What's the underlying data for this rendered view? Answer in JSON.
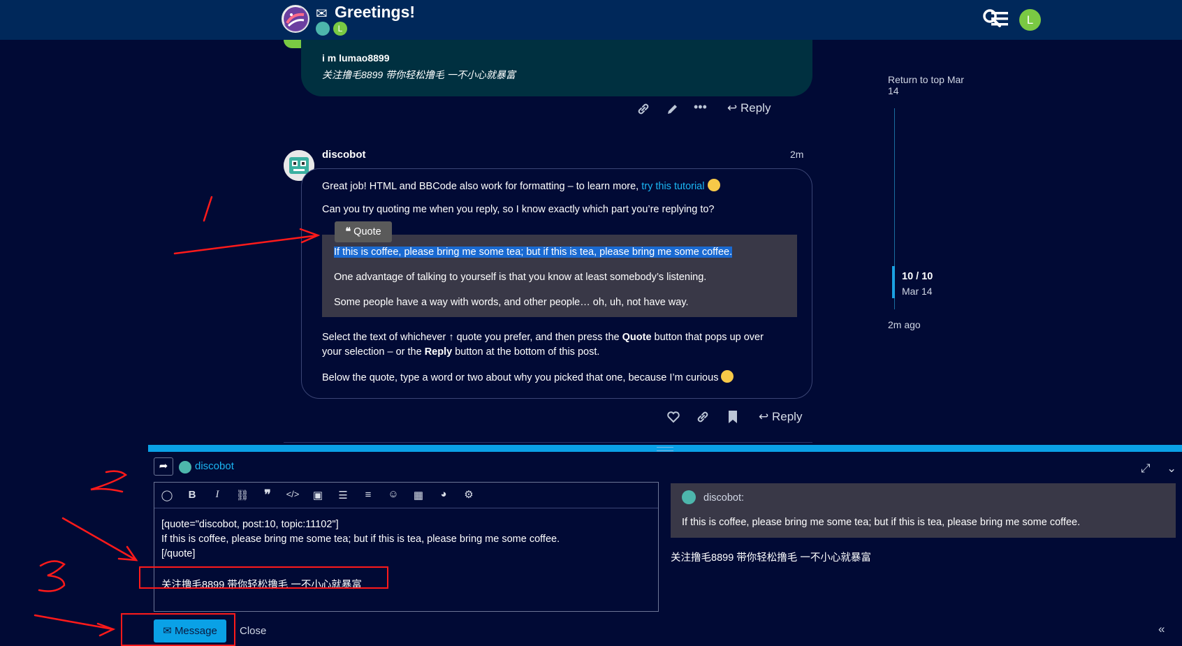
{
  "header": {
    "env_icon": "envelope-icon",
    "title": "Greetings!",
    "participant_2_initial": "L",
    "user_initial": "L"
  },
  "post1": {
    "line1": "i m lumao8899",
    "line2": "关注撸毛8899 带你轻松撸毛 一不小心就暴富",
    "reply_label": "Reply"
  },
  "post2": {
    "author": "discobot",
    "time": "2m",
    "p1_text": "Great job! HTML and BBCode also work for formatting – to learn more, ",
    "p1_link": "try this tutorial",
    "p2": "Can you try quoting me when you reply, so I know exactly which part you’re replying to?",
    "quotes": [
      "If this is coffee, please bring me some tea; but if this is tea, please bring me some coffee.",
      "One advantage of talking to yourself is that you know at least somebody’s listening.",
      "Some people have a way with words, and other people… oh, uh, not have way."
    ],
    "p3_a": "Select the text of whichever ↑ quote you prefer, and then press the ",
    "p3_b": "Quote",
    "p3_c": " button that pops up over",
    "p3_d": "your selection – or the ",
    "p3_e": "Reply",
    "p3_f": " button at the bottom of this post.",
    "p4": "Below the quote, type a word or two about why you picked that one, because I’m curious",
    "reply_label": "Reply",
    "quote_popup": "Quote"
  },
  "timeline": {
    "top_label": "Return to top Mar",
    "top_label2": "14",
    "position": "10 / 10",
    "position_date": "Mar 14",
    "bottom_label": "2m ago"
  },
  "composer": {
    "reply_to": "discobot",
    "editor_lines": [
      "[quote=\"discobot, post:10, topic:11102\"]",
      "If this is coffee, please bring me some tea; but if this is tea, please bring me some coffee.",
      "[/quote]",
      "关注撸毛8899 带你轻松撸毛 一不小心就暴富"
    ],
    "preview_author": "discobot:",
    "preview_quote": "If this is coffee, please bring me some tea; but if this is tea, please bring me some coffee.",
    "preview_text": "关注撸毛8899 带你轻松撸毛 一不小心就暴富",
    "submit_label": "Message",
    "close_label": "Close"
  },
  "colors": {
    "background": "#010a35",
    "header": "#00285a",
    "accent": "#0aa1e6",
    "annotation": "#ff1a1a"
  }
}
